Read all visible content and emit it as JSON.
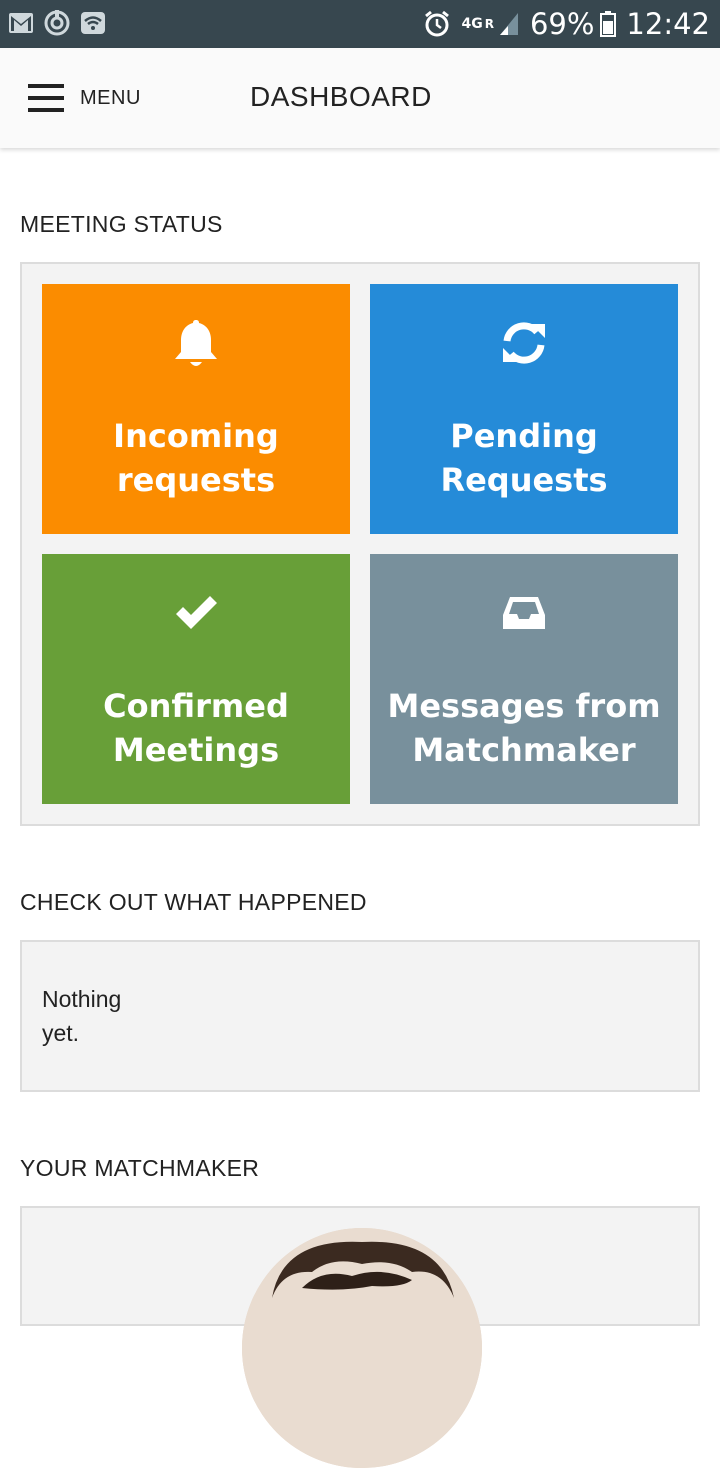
{
  "statusbar": {
    "network": "4G",
    "roaming": "R",
    "battery": "69%",
    "time": "12:42"
  },
  "header": {
    "menu_label": "MENU",
    "title": "DASHBOARD"
  },
  "meeting_status": {
    "title": "MEETING STATUS",
    "tiles": [
      {
        "label": "Incoming requests",
        "icon": "bell-icon",
        "color": "#fb8c00"
      },
      {
        "label": "Pending Requests",
        "icon": "refresh-icon",
        "color": "#258bd8"
      },
      {
        "label": "Confirmed Meetings",
        "icon": "check-icon",
        "color": "#689f38"
      },
      {
        "label": "Messages from Matchmaker",
        "icon": "inbox-icon",
        "color": "#78909c"
      }
    ]
  },
  "activity": {
    "title": "CHECK OUT WHAT HAPPENED",
    "empty_text": "Nothing yet."
  },
  "matchmaker": {
    "title": "YOUR MATCHMAKER"
  }
}
